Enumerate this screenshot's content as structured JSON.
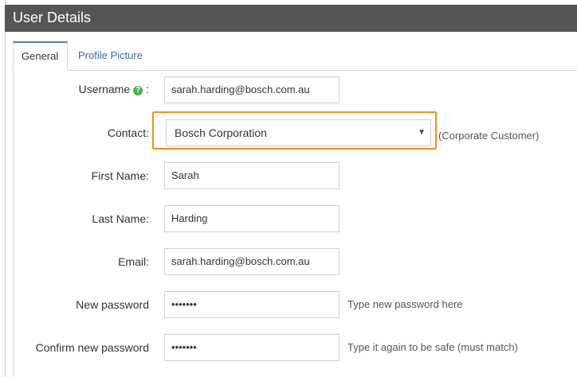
{
  "window": {
    "title": "User Details"
  },
  "tabs": [
    {
      "label": "General",
      "active": true
    },
    {
      "label": "Profile Picture",
      "active": false
    }
  ],
  "form": {
    "username": {
      "label": "Username",
      "colon": ":",
      "value": "sarah.harding@bosch.com.au",
      "help_icon": "question-circle-icon"
    },
    "contact": {
      "label": "Contact:",
      "value": "Bosch Corporation",
      "note": "(Corporate Customer)",
      "highlight_color": "#f0901e"
    },
    "first_name": {
      "label": "First Name:",
      "value": "Sarah"
    },
    "last_name": {
      "label": "Last Name:",
      "value": "Harding"
    },
    "email": {
      "label": "Email:",
      "value": "sarah.harding@bosch.com.au"
    },
    "new_password": {
      "label": "New password",
      "value": "•••••••",
      "hint": "Type new password here"
    },
    "confirm_password": {
      "label": "Confirm new password",
      "value": "•••••••",
      "hint": "Type it again to be safe (must match)"
    }
  },
  "colors": {
    "header_bg": "#555555",
    "accent": "#2f6fa7",
    "help_icon": "#4caf50"
  }
}
